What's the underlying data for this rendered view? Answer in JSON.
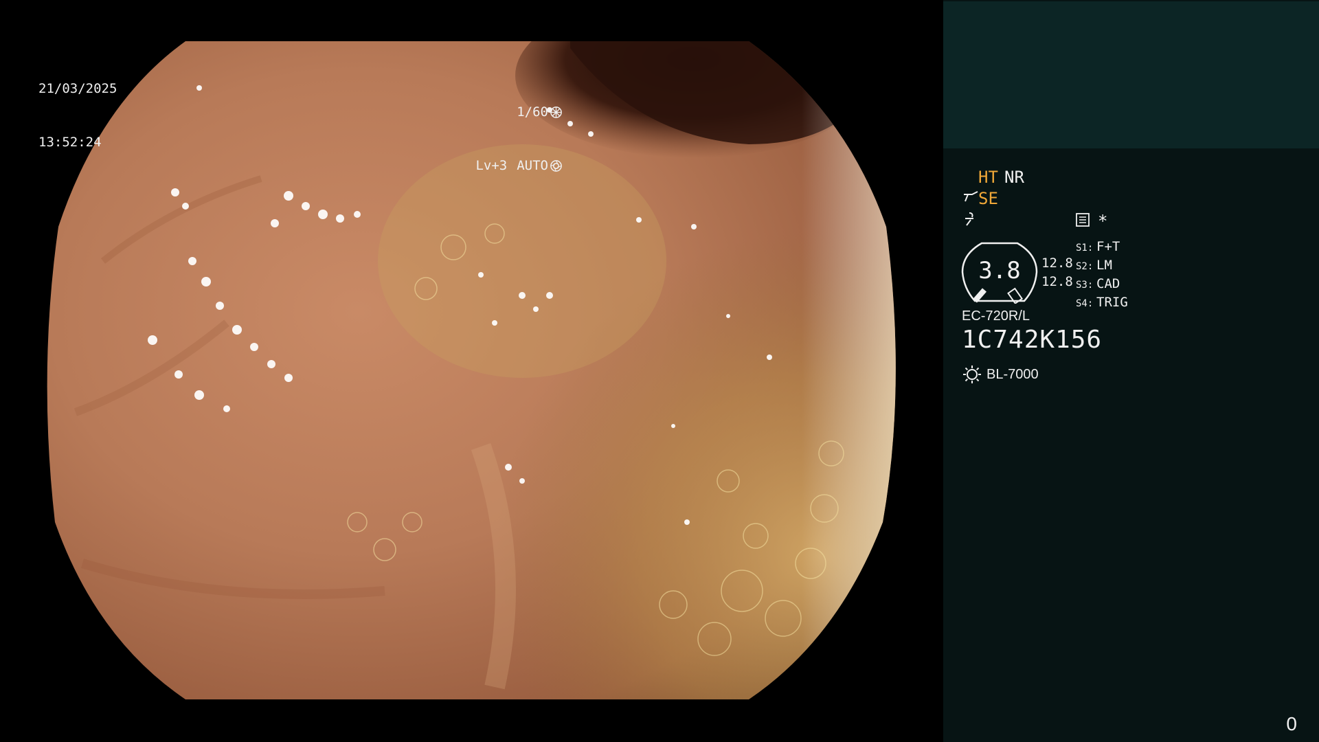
{
  "overlay": {
    "date": "21/03/2025",
    "time": "13:52:24",
    "shutter": "1/60",
    "level": "Lv+3",
    "iris": "AUTO"
  },
  "panel": {
    "mode_ht": "HT",
    "mode_nr": "NR",
    "mode_se": "SE",
    "asterisk": "*",
    "gauge_value": "3.8",
    "depth_top": "12.8",
    "depth_bottom": "12.8",
    "slots": [
      {
        "key": "S1:",
        "value": "F+T"
      },
      {
        "key": "S2:",
        "value": "LM"
      },
      {
        "key": "S3:",
        "value": "CAD"
      },
      {
        "key": "S4:",
        "value": "TRIG"
      }
    ],
    "scope_model": "EC-720R/L",
    "serial": "1C742K156",
    "light_source": "BL-7000",
    "counter": "0"
  },
  "colors": {
    "accent_orange": "#f0a838",
    "panel_bg": "#071414",
    "panel_top_bg": "#0c2525"
  },
  "icons": [
    "shutter-icon",
    "iris-icon",
    "scope-tip-icon",
    "zoom-icon",
    "keypad-icon",
    "sun-icon"
  ]
}
